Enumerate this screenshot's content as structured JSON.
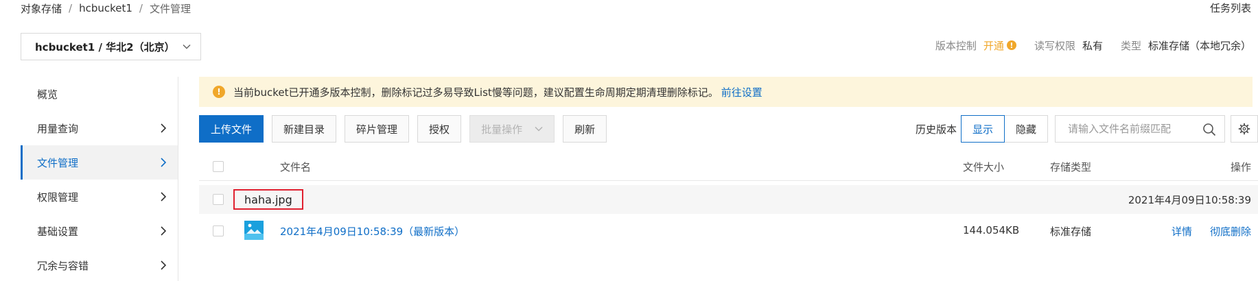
{
  "breadcrumb": {
    "root": "对象存储",
    "bucket": "hcbucket1",
    "current": "文件管理",
    "separator": "/"
  },
  "task_list_label": "任务列表",
  "bucket_selector": {
    "value": "hcbucket1 / 华北2（北京）",
    "icon": "chevron-down-icon"
  },
  "meta": {
    "versioning_label": "版本控制",
    "versioning_value": "开通",
    "warn_glyph": "!",
    "acl_label": "读写权限",
    "acl_value": "私有",
    "type_label": "类型",
    "type_value": "标准存储（本地冗余）"
  },
  "sidebar": {
    "items": [
      {
        "label": "概览",
        "has_arrow": false
      },
      {
        "label": "用量查询",
        "has_arrow": true
      },
      {
        "label": "文件管理",
        "has_arrow": true,
        "active": true
      },
      {
        "label": "权限管理",
        "has_arrow": true
      },
      {
        "label": "基础设置",
        "has_arrow": true
      },
      {
        "label": "冗余与容错",
        "has_arrow": true
      }
    ]
  },
  "notice": {
    "icon_glyph": "!",
    "text": "当前bucket已开通多版本控制，删除标记过多易导致List慢等问题，建议配置生命周期定期清理删除标记。",
    "link": "前往设置"
  },
  "toolbar": {
    "upload": "上传文件",
    "new_dir": "新建目录",
    "fragments": "碎片管理",
    "authorize": "授权",
    "batch": "批量操作",
    "refresh": "刷新"
  },
  "history": {
    "label": "历史版本",
    "show": "显示",
    "hide": "隐藏"
  },
  "search": {
    "placeholder": "请输入文件名前缀匹配"
  },
  "table": {
    "headers": {
      "name": "文件名",
      "size": "文件大小",
      "storage": "存储类型",
      "actions": "操作"
    },
    "group_row": {
      "name": "haha.jpg",
      "date": "2021年4月09日10:58:39"
    },
    "version_row": {
      "name": "2021年4月09日10:58:39（最新版本）",
      "size": "144.054KB",
      "storage": "标准存储",
      "detail": "详情",
      "delete": "彻底删除"
    }
  },
  "colors": {
    "accent": "#0f6ec7",
    "warning": "#f0a72a",
    "highlight_border": "#e0202f",
    "notice_bg": "#fdf5dc"
  }
}
